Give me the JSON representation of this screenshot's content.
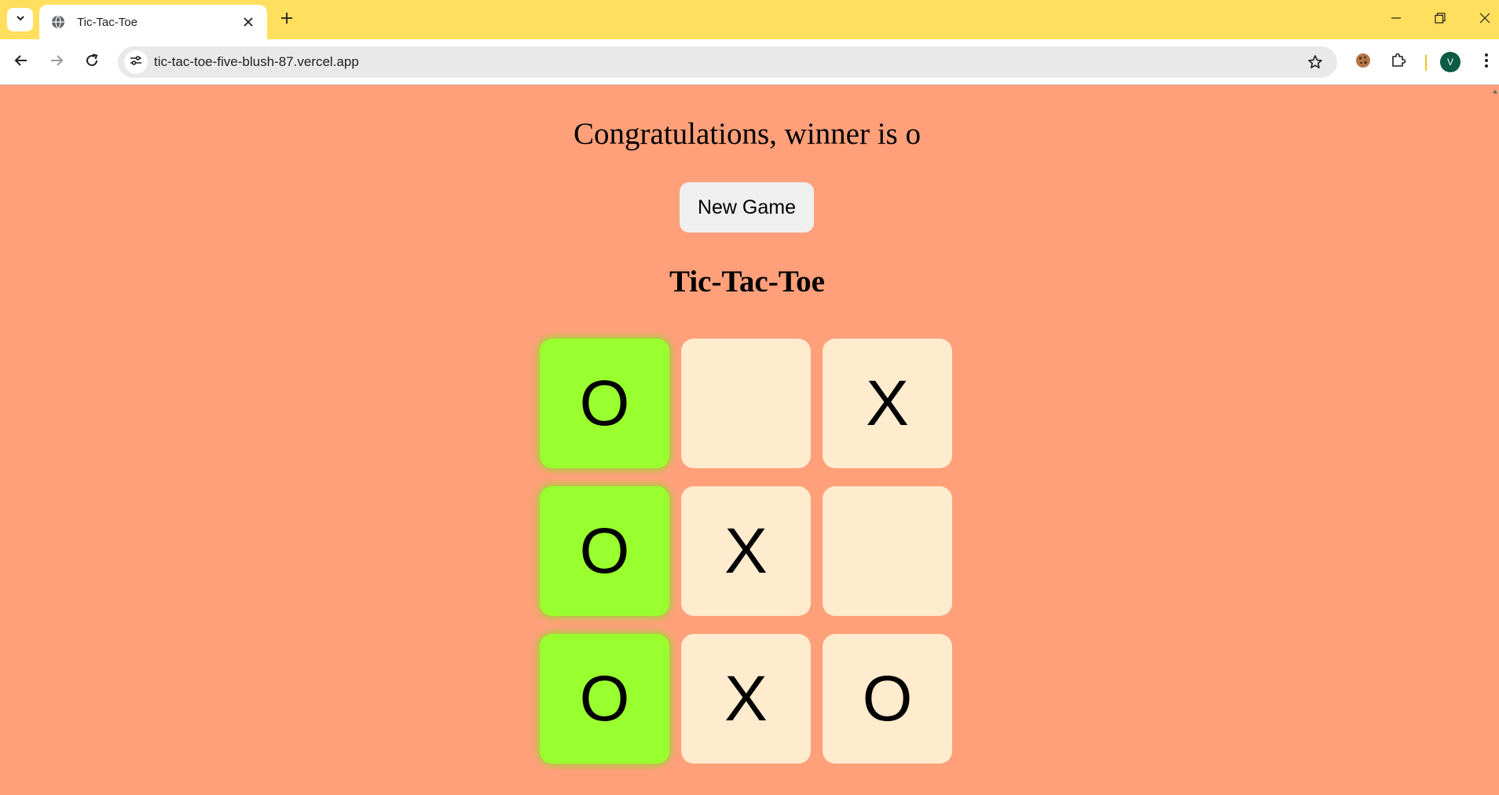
{
  "browser": {
    "tab_title": "Tic-Tac-Toe",
    "url": "tic-tac-toe-five-blush-87.vercel.app",
    "profile_initial": "V",
    "icons": [
      "tab-search-icon",
      "globe-icon",
      "close-icon",
      "plus-icon",
      "minimize-icon",
      "restore-icon",
      "back-icon",
      "forward-icon",
      "reload-icon",
      "site-settings-icon",
      "star-icon",
      "cookie-icon",
      "extensions-icon",
      "kebab-menu-icon"
    ]
  },
  "page": {
    "winner_text": "Congratulations, winner is o",
    "new_game_label": "New Game",
    "heading": "Tic-Tac-Toe",
    "background_color": "#FFA07A",
    "cell_color": "#FFEBCD",
    "win_color": "#9AFF2E"
  },
  "board": {
    "cells": [
      "O",
      "",
      "X",
      "O",
      "X",
      "",
      "O",
      "X",
      "O"
    ],
    "winning_cells": [
      true,
      false,
      false,
      true,
      false,
      false,
      true,
      false,
      false
    ]
  }
}
